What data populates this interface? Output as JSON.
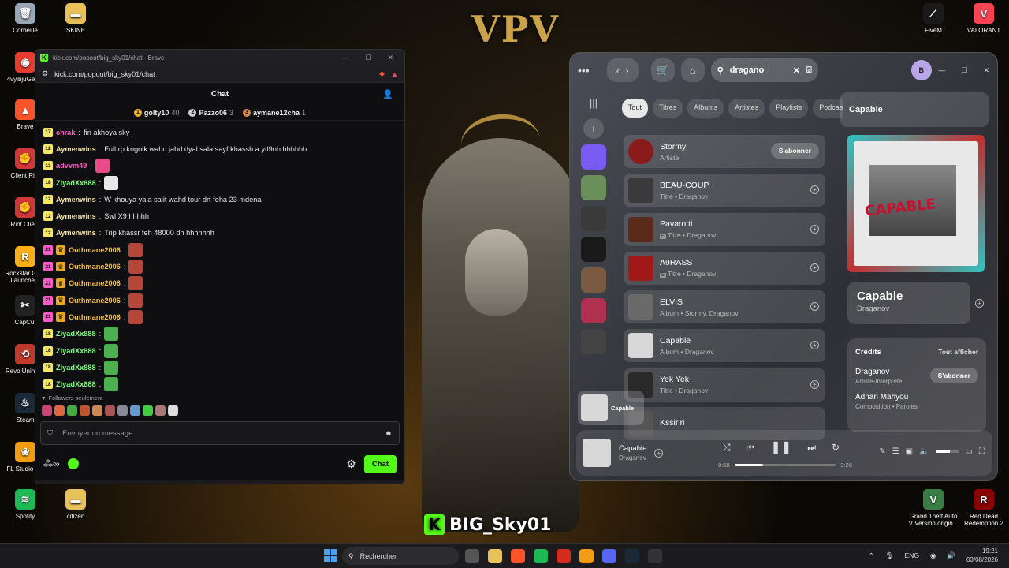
{
  "desktop": {
    "wallpaper_text": "VPV",
    "left_icons": [
      {
        "label": "Corbeille",
        "icon": "recycle-bin-icon",
        "color": "#9aa7b6",
        "glyph": "🗑"
      },
      {
        "label": "4vyibjuGeP...",
        "icon": "app-icon",
        "color": "#e63b2e",
        "glyph": "◉"
      },
      {
        "label": "Brave",
        "icon": "brave-icon",
        "color": "#fb542b",
        "glyph": "▲"
      },
      {
        "label": "Client Ri...",
        "icon": "riot-client-icon",
        "color": "#d13639",
        "glyph": "✊"
      },
      {
        "label": "Riot Clie...",
        "icon": "riot-client-icon",
        "color": "#d13639",
        "glyph": "✊"
      },
      {
        "label": "Rockstar Ga... Launche...",
        "icon": "rockstar-icon",
        "color": "#fcaf17",
        "glyph": "R"
      },
      {
        "label": "CapCut",
        "icon": "capcut-icon",
        "color": "#222222",
        "glyph": "✂"
      },
      {
        "label": "Revo Uninst...",
        "icon": "revo-icon",
        "color": "#c0392b",
        "glyph": "⟲"
      },
      {
        "label": "Steam",
        "icon": "steam-icon",
        "color": "#1b2838",
        "glyph": "♨"
      },
      {
        "label": "FL Studio 2...",
        "icon": "fl-studio-icon",
        "color": "#f39c12",
        "glyph": "❀"
      },
      {
        "label": "Spotify",
        "icon": "spotify-icon",
        "color": "#1db954",
        "glyph": "≋"
      }
    ],
    "second_col_icons": [
      {
        "label": "SKINE",
        "icon": "folder-icon",
        "color": "#e8c15a",
        "glyph": "▬"
      },
      {
        "label": "citizen",
        "icon": "folder-icon",
        "color": "#e8c15a",
        "glyph": "▬"
      }
    ],
    "right_icons": [
      {
        "label": "FiveM",
        "icon": "fivem-icon",
        "color": "#1a1a1a",
        "glyph": "⟋"
      },
      {
        "label": "VALORANT",
        "icon": "valorant-icon",
        "color": "#fa4454",
        "glyph": "V"
      },
      {
        "label": "Grand Theft Auto V Version origin...",
        "icon": "gta-icon",
        "color": "#3a7d44",
        "glyph": "V"
      },
      {
        "label": "Red Dead Redemption 2",
        "icon": "rdr2-icon",
        "color": "#8b0000",
        "glyph": "R"
      }
    ],
    "stream_tag": "BIG_Sky01",
    "stream_k": "K"
  },
  "browser": {
    "title": "kick.com/popout/big_sky01/chat - Brave",
    "url": "kick.com/popout/big_sky01/chat",
    "chat_title": "Chat",
    "leaders": [
      {
        "rank": "1",
        "name": "golty10",
        "count": "40",
        "color": "#f0b429"
      },
      {
        "rank": "2",
        "name": "Pazzo06",
        "count": "3",
        "color": "#d0d0d0"
      },
      {
        "rank": "3",
        "name": "aymane12cha",
        "count": "1",
        "color": "#d98b4a"
      }
    ],
    "messages": [
      {
        "badge": "17",
        "badge_color": "#f5e663",
        "user": "chrak",
        "user_color": "#ff5ac8",
        "text": "fin akhoya sky",
        "emote": ""
      },
      {
        "badge": "12",
        "badge_color": "#f5e663",
        "user": "Aymenwins",
        "user_color": "#f5e29a",
        "text": "Full rp kngolk wahd jahd dyal sala sayf khassh a ytl9oh hhhhhh",
        "emote": ""
      },
      {
        "badge": "13",
        "badge_color": "#f5e663",
        "user": "advvm49",
        "user_color": "#ff5ac8",
        "text": "",
        "emote": "#e84a8a"
      },
      {
        "badge": "18",
        "badge_color": "#f5e663",
        "user": "ZiyadXx888",
        "user_color": "#7cfc7c",
        "text": "",
        "emote": "#e8e8e8"
      },
      {
        "badge": "12",
        "badge_color": "#f5e663",
        "user": "Aymenwins",
        "user_color": "#f5e29a",
        "text": "W khouya yala salit wahd tour drt feha 23 mdena",
        "emote": ""
      },
      {
        "badge": "12",
        "badge_color": "#f5e663",
        "user": "Aymenwins",
        "user_color": "#f5e29a",
        "text": "Swl X9 hhhhh",
        "emote": ""
      },
      {
        "badge": "12",
        "badge_color": "#f5e663",
        "user": "Aymenwins",
        "user_color": "#f5e29a",
        "text": "Trip khassr feh 48000 dh hhhhhhh",
        "emote": ""
      },
      {
        "badge": "21",
        "badge_color": "#ff5ac8",
        "crown": true,
        "user": "Outhmane2006",
        "user_color": "#f5c242",
        "text": "",
        "emote": "#b5473a"
      },
      {
        "badge": "21",
        "badge_color": "#ff5ac8",
        "crown": true,
        "user": "Outhmane2006",
        "user_color": "#f5c242",
        "text": "",
        "emote": "#b5473a"
      },
      {
        "badge": "21",
        "badge_color": "#ff5ac8",
        "crown": true,
        "user": "Outhmane2006",
        "user_color": "#f5c242",
        "text": "",
        "emote": "#b5473a"
      },
      {
        "badge": "21",
        "badge_color": "#ff5ac8",
        "crown": true,
        "user": "Outhmane2006",
        "user_color": "#f5c242",
        "text": "",
        "emote": "#b5473a"
      },
      {
        "badge": "21",
        "badge_color": "#ff5ac8",
        "crown": true,
        "user": "Outhmane2006",
        "user_color": "#f5c242",
        "text": "",
        "emote": "#b5473a"
      },
      {
        "badge": "18",
        "badge_color": "#f5e663",
        "user": "ZiyadXx888",
        "user_color": "#7cfc7c",
        "text": "",
        "emote": "#4caf50"
      },
      {
        "badge": "18",
        "badge_color": "#f5e663",
        "user": "ZiyadXx888",
        "user_color": "#7cfc7c",
        "text": "",
        "emote": "#4caf50"
      },
      {
        "badge": "18",
        "badge_color": "#f5e663",
        "user": "ZiyadXx888",
        "user_color": "#7cfc7c",
        "text": "",
        "emote": "#4caf50"
      },
      {
        "badge": "18",
        "badge_color": "#f5e663",
        "user": "ZiyadXx888",
        "user_color": "#7cfc7c",
        "text": "",
        "emote": "#4caf50"
      }
    ],
    "followers_only": "Followers seulement",
    "emote_colors": [
      "#c47",
      "#d64",
      "#4a4",
      "#b53",
      "#c85",
      "#a55",
      "#889",
      "#69c",
      "#4c4",
      "#a77",
      "#ddd"
    ],
    "input_placeholder": "Envoyer un message",
    "chat_button": "Chat"
  },
  "spotify": {
    "search_value": "dragano",
    "avatar_letter": "B",
    "filters": [
      {
        "label": "Tout",
        "active": true
      },
      {
        "label": "Titres",
        "active": false
      },
      {
        "label": "Albums",
        "active": false
      },
      {
        "label": "Artistes",
        "active": false
      },
      {
        "label": "Playlists",
        "active": false
      },
      {
        "label": "Podcasts",
        "active": false
      }
    ],
    "sidebar_tiles": [
      "#7a5cf5",
      "#6b8f5a",
      "#3a3a3a",
      "#1a1a1a",
      "#7a5a40",
      "#b03050",
      "#444"
    ],
    "results": [
      {
        "title": "Stormy",
        "sub": "Artiste",
        "explicit": false,
        "thumb": "#8b1a1a",
        "subscribe": true
      },
      {
        "title": "BEAU-COUP",
        "sub": "Titre • Draganov",
        "explicit": false,
        "thumb": "#3a3a3a",
        "subscribe": false
      },
      {
        "title": "Pavarotti",
        "sub": "Titre • Draganov",
        "explicit": true,
        "thumb": "#5a2a1a",
        "subscribe": false
      },
      {
        "title": "A9RASS",
        "sub": "Titre • Draganov",
        "explicit": true,
        "thumb": "#a01818",
        "subscribe": false
      },
      {
        "title": "ELVIS",
        "sub": "Album • Stormy, Draganov",
        "explicit": false,
        "thumb": "#6a6a6a",
        "subscribe": false
      },
      {
        "title": "Capable",
        "sub": "Album • Draganov",
        "explicit": false,
        "thumb": "#d8d8d8",
        "subscribe": false
      },
      {
        "title": "Yek Yek",
        "sub": "Titre • Draganov",
        "explicit": false,
        "thumb": "#2a2a2a",
        "subscribe": false
      },
      {
        "title": "Kssiriri",
        "sub": "",
        "explicit": false,
        "thumb": "#555",
        "subscribe": false
      }
    ],
    "subscribe_label": "S'abonner",
    "right_head": "Capable",
    "cover_text": "CAPABLE",
    "track_title": "Capable",
    "track_artist": "Draganov",
    "credits_label": "Crédits",
    "show_all": "Tout afficher",
    "credits": [
      {
        "name": "Draganov",
        "role": "Artiste-Interprète"
      },
      {
        "name": "Adnan Mahyou",
        "role": "Composition • Paroles"
      }
    ],
    "mini_title": "Capable",
    "now_playing": {
      "title": "Capable",
      "artist": "Draganov",
      "elapsed": "0:58",
      "total": "3:26",
      "progress": 0.28,
      "volume": 0.6
    }
  },
  "taskbar": {
    "search_placeholder": "Rechercher",
    "apps": [
      {
        "icon": "file-explorer-icon",
        "color": "#555"
      },
      {
        "icon": "folder-icon",
        "color": "#e8c15a"
      },
      {
        "icon": "brave-icon",
        "color": "#fb542b"
      },
      {
        "icon": "spotify-icon",
        "color": "#1db954"
      },
      {
        "icon": "ea-app-icon",
        "color": "#d52b1e"
      },
      {
        "icon": "fl-studio-icon",
        "color": "#f39c12"
      },
      {
        "icon": "discord-icon",
        "color": "#5865f2"
      },
      {
        "icon": "steam-icon",
        "color": "#1b2838"
      },
      {
        "icon": "obs-icon",
        "color": "#333"
      }
    ],
    "lang": "ENG",
    "time": "19:21",
    "date": "03/08/2026"
  }
}
